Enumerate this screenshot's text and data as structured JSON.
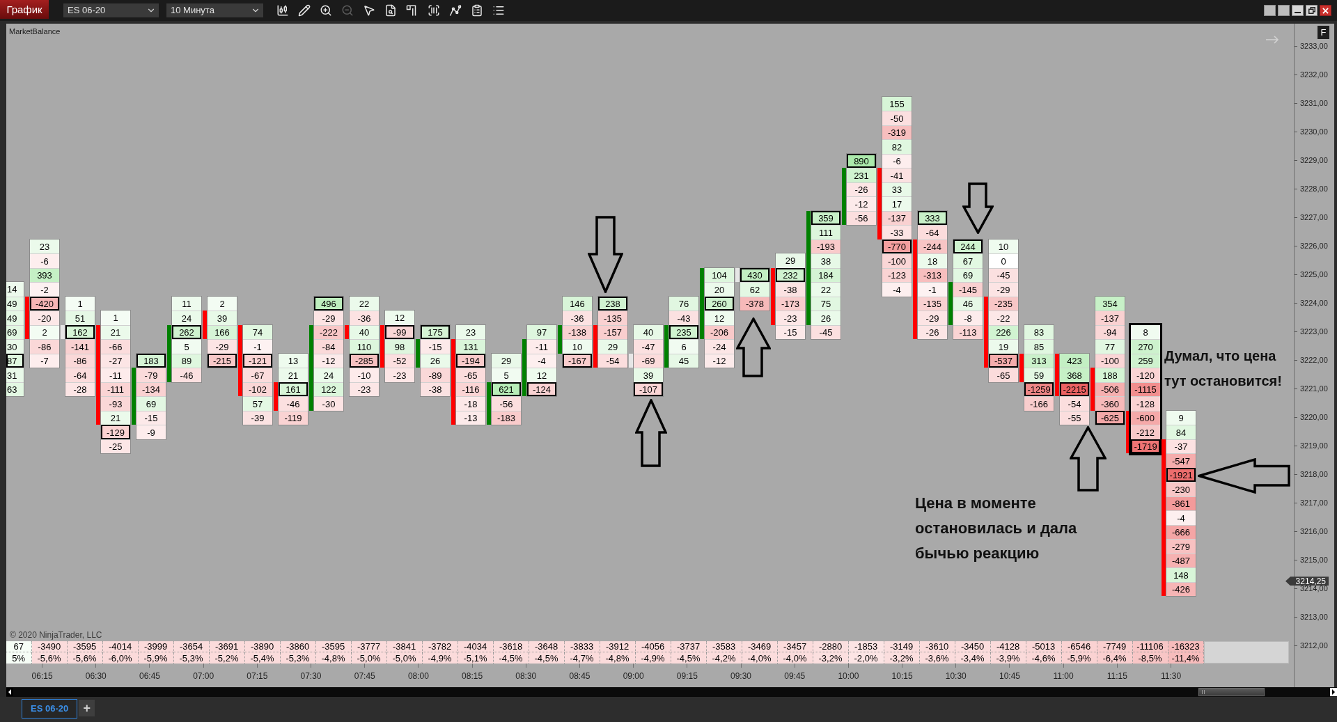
{
  "toolbar": {
    "chart_button": "График",
    "instrument": "ES 06-20",
    "interval": "10 Минута",
    "tools": [
      {
        "disabled": false
      },
      {
        "disabled": false
      },
      {
        "disabled": false
      },
      {
        "disabled": true
      },
      {
        "disabled": false
      },
      {
        "disabled": false
      },
      {
        "disabled": false
      },
      {
        "disabled": false
      },
      {
        "disabled": false
      },
      {
        "disabled": false
      },
      {
        "disabled": false
      }
    ]
  },
  "chart": {
    "indicator": "MarketBalance",
    "corner_button": "F",
    "columns": [
      {
        "clipped": true,
        "framed": false,
        "cells": [
          {
            "value": "14",
            "outlined": false
          },
          {
            "value": "49",
            "outlined": false
          },
          {
            "value": "49",
            "outlined": false
          },
          {
            "value": "69",
            "outlined": false
          },
          {
            "value": "30",
            "outlined": false
          },
          {
            "value": "87",
            "outlined": true
          },
          {
            "value": "31",
            "outlined": false
          },
          {
            "value": "63",
            "outlined": false
          }
        ]
      },
      {
        "clipped": false,
        "framed": false,
        "body": {
          "color": "#ff0000"
        },
        "cells": [
          {
            "value": "23",
            "outlined": false
          },
          {
            "value": "-6",
            "outlined": false
          },
          {
            "value": "393",
            "outlined": false
          },
          {
            "value": "-2",
            "outlined": false
          },
          {
            "value": "-420",
            "outlined": true
          },
          {
            "value": "-20",
            "outlined": false
          },
          {
            "value": "2",
            "outlined": false
          },
          {
            "value": "-86",
            "outlined": false
          },
          {
            "value": "-7",
            "outlined": false
          }
        ]
      },
      {
        "clipped": false,
        "framed": false,
        "body": {
          "color": "#e6e6e6"
        },
        "cells": [
          {
            "value": "1",
            "outlined": false
          },
          {
            "value": "51",
            "outlined": false
          },
          {
            "value": "162",
            "outlined": true
          },
          {
            "value": "-141",
            "outlined": false
          },
          {
            "value": "-86",
            "outlined": false
          },
          {
            "value": "-64",
            "outlined": false
          },
          {
            "value": "-28",
            "outlined": false
          }
        ]
      },
      {
        "clipped": false,
        "framed": false,
        "body": {
          "color": "#ff0000"
        },
        "cells": [
          {
            "value": "1",
            "outlined": false
          },
          {
            "value": "21",
            "outlined": false
          },
          {
            "value": "-66",
            "outlined": false
          },
          {
            "value": "-27",
            "outlined": false
          },
          {
            "value": "-11",
            "outlined": false
          },
          {
            "value": "-111",
            "outlined": false
          },
          {
            "value": "-93",
            "outlined": false
          },
          {
            "value": "21",
            "outlined": false
          },
          {
            "value": "-129",
            "outlined": true
          },
          {
            "value": "-25",
            "outlined": false
          }
        ]
      },
      {
        "clipped": false,
        "framed": false,
        "body": {
          "color": "#008000"
        },
        "cells": [
          {
            "value": "183",
            "outlined": true
          },
          {
            "value": "-79",
            "outlined": false
          },
          {
            "value": "-134",
            "outlined": false
          },
          {
            "value": "69",
            "outlined": false
          },
          {
            "value": "-15",
            "outlined": false
          },
          {
            "value": "-9",
            "outlined": false
          }
        ]
      },
      {
        "clipped": false,
        "framed": false,
        "body": {
          "color": "#008000"
        },
        "cells": [
          {
            "value": "11",
            "outlined": false
          },
          {
            "value": "24",
            "outlined": false
          },
          {
            "value": "262",
            "outlined": true
          },
          {
            "value": "5",
            "outlined": false
          },
          {
            "value": "89",
            "outlined": false
          },
          {
            "value": "-46",
            "outlined": false
          }
        ]
      },
      {
        "clipped": false,
        "framed": false,
        "body": {
          "color": "#ff0000"
        },
        "cells": [
          {
            "value": "2",
            "outlined": false
          },
          {
            "value": "39",
            "outlined": false
          },
          {
            "value": "166",
            "outlined": false
          },
          {
            "value": "-29",
            "outlined": false
          },
          {
            "value": "-215",
            "outlined": true
          }
        ]
      },
      {
        "clipped": false,
        "framed": false,
        "body": {
          "color": "#ff0000"
        },
        "cells": [
          {
            "value": "74",
            "outlined": false
          },
          {
            "value": "-1",
            "outlined": false
          },
          {
            "value": "-121",
            "outlined": true
          },
          {
            "value": "-67",
            "outlined": false
          },
          {
            "value": "-102",
            "outlined": false
          },
          {
            "value": "57",
            "outlined": false
          },
          {
            "value": "-39",
            "outlined": false
          }
        ]
      },
      {
        "clipped": false,
        "framed": false,
        "body": {
          "color": "#ff0000"
        },
        "cells": [
          {
            "value": "13",
            "outlined": false
          },
          {
            "value": "21",
            "outlined": false
          },
          {
            "value": "161",
            "outlined": true
          },
          {
            "value": "-46",
            "outlined": false
          },
          {
            "value": "-119",
            "outlined": false
          }
        ]
      },
      {
        "clipped": false,
        "framed": false,
        "body": {
          "color": "#008000"
        },
        "cells": [
          {
            "value": "496",
            "outlined": true
          },
          {
            "value": "-29",
            "outlined": false
          },
          {
            "value": "-222",
            "outlined": false
          },
          {
            "value": "-84",
            "outlined": false
          },
          {
            "value": "-12",
            "outlined": false
          },
          {
            "value": "24",
            "outlined": false
          },
          {
            "value": "122",
            "outlined": false
          },
          {
            "value": "-30",
            "outlined": false
          }
        ]
      },
      {
        "clipped": false,
        "framed": false,
        "body": {
          "color": "#ff0000"
        },
        "cells": [
          {
            "value": "22",
            "outlined": false
          },
          {
            "value": "-36",
            "outlined": false
          },
          {
            "value": "40",
            "outlined": false
          },
          {
            "value": "110",
            "outlined": false
          },
          {
            "value": "-285",
            "outlined": true
          },
          {
            "value": "-10",
            "outlined": false
          },
          {
            "value": "-23",
            "outlined": false
          }
        ]
      },
      {
        "clipped": false,
        "framed": false,
        "body": {
          "color": "#ff0000"
        },
        "cells": [
          {
            "value": "12",
            "outlined": false
          },
          {
            "value": "-99",
            "outlined": true
          },
          {
            "value": "98",
            "outlined": false
          },
          {
            "value": "-52",
            "outlined": false
          },
          {
            "value": "-23",
            "outlined": false
          }
        ]
      },
      {
        "clipped": false,
        "framed": false,
        "body": {
          "color": "#008000"
        },
        "cells": [
          {
            "value": "175",
            "outlined": true
          },
          {
            "value": "-15",
            "outlined": false
          },
          {
            "value": "26",
            "outlined": false
          },
          {
            "value": "-89",
            "outlined": false
          },
          {
            "value": "-38",
            "outlined": false
          }
        ]
      },
      {
        "clipped": false,
        "framed": false,
        "body": {
          "color": "#ff0000"
        },
        "cells": [
          {
            "value": "23",
            "outlined": false
          },
          {
            "value": "131",
            "outlined": false
          },
          {
            "value": "-194",
            "outlined": true
          },
          {
            "value": "-65",
            "outlined": false
          },
          {
            "value": "-116",
            "outlined": false
          },
          {
            "value": "-18",
            "outlined": false
          },
          {
            "value": "-13",
            "outlined": false
          }
        ]
      },
      {
        "clipped": false,
        "framed": false,
        "body": {
          "color": "#008000"
        },
        "cells": [
          {
            "value": "29",
            "outlined": false
          },
          {
            "value": "5",
            "outlined": false
          },
          {
            "value": "621",
            "outlined": true
          },
          {
            "value": "-56",
            "outlined": false
          },
          {
            "value": "-183",
            "outlined": false
          }
        ]
      },
      {
        "clipped": false,
        "framed": false,
        "body": {
          "color": "#008000"
        },
        "cells": [
          {
            "value": "97",
            "outlined": false
          },
          {
            "value": "-11",
            "outlined": false
          },
          {
            "value": "-4",
            "outlined": false
          },
          {
            "value": "12",
            "outlined": false
          },
          {
            "value": "-124",
            "outlined": true
          }
        ]
      },
      {
        "clipped": false,
        "framed": false,
        "body": {
          "color": "#008000"
        },
        "cells": [
          {
            "value": "146",
            "outlined": false
          },
          {
            "value": "-36",
            "outlined": false
          },
          {
            "value": "-138",
            "outlined": false
          },
          {
            "value": "10",
            "outlined": false
          },
          {
            "value": "-167",
            "outlined": true
          }
        ]
      },
      {
        "clipped": false,
        "framed": false,
        "body": {
          "color": "#ff0000"
        },
        "cells": [
          {
            "value": "238",
            "outlined": true
          },
          {
            "value": "-135",
            "outlined": false
          },
          {
            "value": "-157",
            "outlined": false
          },
          {
            "value": "29",
            "outlined": false
          },
          {
            "value": "-54",
            "outlined": false
          }
        ]
      },
      {
        "clipped": false,
        "framed": false,
        "body": {
          "color": "#e6e6e6"
        },
        "cells": [
          {
            "value": "40",
            "outlined": false
          },
          {
            "value": "-47",
            "outlined": false
          },
          {
            "value": "-69",
            "outlined": false
          },
          {
            "value": "39",
            "outlined": false
          },
          {
            "value": "-107",
            "outlined": true
          }
        ]
      },
      {
        "clipped": false,
        "framed": false,
        "body": {
          "color": "#008000"
        },
        "cells": [
          {
            "value": "76",
            "outlined": false
          },
          {
            "value": "-43",
            "outlined": false
          },
          {
            "value": "235",
            "outlined": true
          },
          {
            "value": "6",
            "outlined": false
          },
          {
            "value": "45",
            "outlined": false
          }
        ]
      },
      {
        "clipped": false,
        "framed": false,
        "body": {
          "color": "#008000"
        },
        "cells": [
          {
            "value": "104",
            "outlined": false
          },
          {
            "value": "20",
            "outlined": false
          },
          {
            "value": "260",
            "outlined": true
          },
          {
            "value": "12",
            "outlined": false
          },
          {
            "value": "-206",
            "outlined": false
          },
          {
            "value": "-24",
            "outlined": false
          },
          {
            "value": "-12",
            "outlined": false
          }
        ]
      },
      {
        "clipped": false,
        "framed": false,
        "body": {
          "color": "#e6e6e6"
        },
        "cells": [
          {
            "value": "430",
            "outlined": true
          },
          {
            "value": "62",
            "outlined": false
          },
          {
            "value": "-378",
            "outlined": false
          }
        ]
      },
      {
        "clipped": false,
        "framed": false,
        "body": {
          "color": "#ff0000"
        },
        "cells": [
          {
            "value": "29",
            "outlined": false
          },
          {
            "value": "232",
            "outlined": true
          },
          {
            "value": "-38",
            "outlined": false
          },
          {
            "value": "-173",
            "outlined": false
          },
          {
            "value": "-23",
            "outlined": false
          },
          {
            "value": "-15",
            "outlined": false
          }
        ]
      },
      {
        "clipped": false,
        "framed": false,
        "body": {
          "color": "#008000"
        },
        "cells": [
          {
            "value": "359",
            "outlined": true
          },
          {
            "value": "111",
            "outlined": false
          },
          {
            "value": "-193",
            "outlined": false
          },
          {
            "value": "38",
            "outlined": false
          },
          {
            "value": "184",
            "outlined": false
          },
          {
            "value": "22",
            "outlined": false
          },
          {
            "value": "75",
            "outlined": false
          },
          {
            "value": "26",
            "outlined": false
          },
          {
            "value": "-45",
            "outlined": false
          }
        ]
      },
      {
        "clipped": false,
        "framed": false,
        "body": {
          "color": "#008000"
        },
        "cells": [
          {
            "value": "890",
            "outlined": true
          },
          {
            "value": "231",
            "outlined": false
          },
          {
            "value": "-26",
            "outlined": false
          },
          {
            "value": "-12",
            "outlined": false
          },
          {
            "value": "-56",
            "outlined": false
          }
        ]
      },
      {
        "clipped": false,
        "framed": false,
        "body": {
          "color": "#ff0000"
        },
        "cells": [
          {
            "value": "155",
            "outlined": false
          },
          {
            "value": "-50",
            "outlined": false
          },
          {
            "value": "-319",
            "outlined": false
          },
          {
            "value": "82",
            "outlined": false
          },
          {
            "value": "-6",
            "outlined": false
          },
          {
            "value": "-41",
            "outlined": false
          },
          {
            "value": "33",
            "outlined": false
          },
          {
            "value": "17",
            "outlined": false
          },
          {
            "value": "-137",
            "outlined": false
          },
          {
            "value": "-33",
            "outlined": false
          },
          {
            "value": "-770",
            "outlined": true
          },
          {
            "value": "-100",
            "outlined": false
          },
          {
            "value": "-123",
            "outlined": false
          },
          {
            "value": "-4",
            "outlined": false
          }
        ]
      },
      {
        "clipped": false,
        "framed": false,
        "body": {
          "color": "#ff0000"
        },
        "cells": [
          {
            "value": "333",
            "outlined": true
          },
          {
            "value": "-64",
            "outlined": false
          },
          {
            "value": "-244",
            "outlined": false
          },
          {
            "value": "18",
            "outlined": false
          },
          {
            "value": "-313",
            "outlined": false
          },
          {
            "value": "-1",
            "outlined": false
          },
          {
            "value": "-135",
            "outlined": false
          },
          {
            "value": "-29",
            "outlined": false
          },
          {
            "value": "-26",
            "outlined": false
          }
        ]
      },
      {
        "clipped": false,
        "framed": false,
        "body": {
          "color": "#008000"
        },
        "cells": [
          {
            "value": "244",
            "outlined": true
          },
          {
            "value": "67",
            "outlined": false
          },
          {
            "value": "69",
            "outlined": false
          },
          {
            "value": "-145",
            "outlined": false
          },
          {
            "value": "46",
            "outlined": false
          },
          {
            "value": "-8",
            "outlined": false
          },
          {
            "value": "-113",
            "outlined": false
          }
        ]
      },
      {
        "clipped": false,
        "framed": false,
        "body": {
          "color": "#ff0000"
        },
        "cells": [
          {
            "value": "10",
            "outlined": false
          },
          {
            "value": "0",
            "outlined": false
          },
          {
            "value": "-45",
            "outlined": false
          },
          {
            "value": "-29",
            "outlined": false
          },
          {
            "value": "-235",
            "outlined": false
          },
          {
            "value": "-22",
            "outlined": false
          },
          {
            "value": "226",
            "outlined": false
          },
          {
            "value": "19",
            "outlined": false
          },
          {
            "value": "-537",
            "outlined": true
          },
          {
            "value": "-65",
            "outlined": false
          }
        ]
      },
      {
        "clipped": false,
        "framed": false,
        "body": {
          "color": "#ff0000"
        },
        "cells": [
          {
            "value": "83",
            "outlined": false
          },
          {
            "value": "85",
            "outlined": false
          },
          {
            "value": "313",
            "outlined": false
          },
          {
            "value": "59",
            "outlined": false
          },
          {
            "value": "-1259",
            "outlined": true
          },
          {
            "value": "-166",
            "outlined": false
          }
        ]
      },
      {
        "clipped": false,
        "framed": false,
        "body": {
          "color": "#ff0000"
        },
        "cells": [
          {
            "value": "423",
            "outlined": false
          },
          {
            "value": "368",
            "outlined": false
          },
          {
            "value": "-2215",
            "outlined": true
          },
          {
            "value": "-54",
            "outlined": false
          },
          {
            "value": "-55",
            "outlined": false
          }
        ]
      },
      {
        "clipped": false,
        "framed": false,
        "body": {
          "color": "#ff0000"
        },
        "cells": [
          {
            "value": "354",
            "outlined": false
          },
          {
            "value": "-137",
            "outlined": false
          },
          {
            "value": "-94",
            "outlined": false
          },
          {
            "value": "77",
            "outlined": false
          },
          {
            "value": "-100",
            "outlined": false
          },
          {
            "value": "188",
            "outlined": false
          },
          {
            "value": "-506",
            "outlined": false
          },
          {
            "value": "-360",
            "outlined": false
          },
          {
            "value": "-625",
            "outlined": true
          }
        ]
      },
      {
        "clipped": false,
        "framed": true,
        "body": {
          "color": "#ff0000"
        },
        "cells": [
          {
            "value": "8",
            "outlined": false
          },
          {
            "value": "270",
            "outlined": false
          },
          {
            "value": "259",
            "outlined": false
          },
          {
            "value": "-120",
            "outlined": false
          },
          {
            "value": "-1115",
            "outlined": false
          },
          {
            "value": "-128",
            "outlined": false
          },
          {
            "value": "-600",
            "outlined": false
          },
          {
            "value": "-212",
            "outlined": false
          },
          {
            "value": "-1719",
            "outlined": true
          }
        ]
      },
      {
        "clipped": false,
        "framed": false,
        "body": {
          "color": "#ff0000"
        },
        "cells": [
          {
            "value": "9",
            "outlined": false
          },
          {
            "value": "84",
            "outlined": false
          },
          {
            "value": "-37",
            "outlined": false
          },
          {
            "value": "-547",
            "outlined": false
          },
          {
            "value": "-1921",
            "outlined": true
          },
          {
            "value": "-230",
            "outlined": false
          },
          {
            "value": "-861",
            "outlined": false
          },
          {
            "value": "-4",
            "outlined": false
          },
          {
            "value": "-666",
            "outlined": false
          },
          {
            "value": "-279",
            "outlined": false
          },
          {
            "value": "-487",
            "outlined": false
          },
          {
            "value": "148",
            "outlined": false
          },
          {
            "value": "-426",
            "outlined": false
          }
        ]
      }
    ],
    "delta_table": [
      {
        "delta": "67",
        "percent": "5%"
      },
      {
        "delta": "-3490",
        "percent": "-5,6%"
      },
      {
        "delta": "-3595",
        "percent": "-5,6%"
      },
      {
        "delta": "-4014",
        "percent": "-6,0%"
      },
      {
        "delta": "-3999",
        "percent": "-5,9%"
      },
      {
        "delta": "-3654",
        "percent": "-5,3%"
      },
      {
        "delta": "-3691",
        "percent": "-5,2%"
      },
      {
        "delta": "-3890",
        "percent": "-5,4%"
      },
      {
        "delta": "-3860",
        "percent": "-5,3%"
      },
      {
        "delta": "-3595",
        "percent": "-4,8%"
      },
      {
        "delta": "-3777",
        "percent": "-5,0%"
      },
      {
        "delta": "-3841",
        "percent": "-5,0%"
      },
      {
        "delta": "-3782",
        "percent": "-4,9%"
      },
      {
        "delta": "-4034",
        "percent": "-5,1%"
      },
      {
        "delta": "-3618",
        "percent": "-4,5%"
      },
      {
        "delta": "-3648",
        "percent": "-4,5%"
      },
      {
        "delta": "-3833",
        "percent": "-4,7%"
      },
      {
        "delta": "-3912",
        "percent": "-4,8%"
      },
      {
        "delta": "-4056",
        "percent": "-4,9%"
      },
      {
        "delta": "-3737",
        "percent": "-4,5%"
      },
      {
        "delta": "-3583",
        "percent": "-4,2%"
      },
      {
        "delta": "-3469",
        "percent": "-4,0%"
      },
      {
        "delta": "-3457",
        "percent": "-4,0%"
      },
      {
        "delta": "-2880",
        "percent": "-3,2%"
      },
      {
        "delta": "-1853",
        "percent": "-2,0%"
      },
      {
        "delta": "-3149",
        "percent": "-3,2%"
      },
      {
        "delta": "-3610",
        "percent": "-3,6%"
      },
      {
        "delta": "-3450",
        "percent": "-3,4%"
      },
      {
        "delta": "-4128",
        "percent": "-3,9%"
      },
      {
        "delta": "-5013",
        "percent": "-4,6%"
      },
      {
        "delta": "-6546",
        "percent": "-5,9%"
      },
      {
        "delta": "-7749",
        "percent": "-6,4%"
      },
      {
        "delta": "-11106",
        "percent": "-8,5%"
      },
      {
        "delta": "-16323",
        "percent": "-11,4%"
      }
    ],
    "copyright": "© 2020 NinjaTrader, LLC",
    "time_axis": [
      "06:15",
      "06:30",
      "06:45",
      "07:00",
      "07:15",
      "07:30",
      "07:45",
      "08:00",
      "08:15",
      "08:30",
      "08:45",
      "09:00",
      "09:15",
      "09:30",
      "09:45",
      "10:00",
      "10:15",
      "10:30",
      "10:45",
      "11:00",
      "11:15",
      "11:30"
    ],
    "price_axis": {
      "labels": [
        "3233,00",
        "3232,00",
        "3231,00",
        "3230,00",
        "3229,00",
        "3228,00",
        "3227,00",
        "3226,00",
        "3225,00",
        "3224,00",
        "3223,00",
        "3222,00",
        "3221,00",
        "3220,00",
        "3219,00",
        "3218,00",
        "3217,00",
        "3216,00",
        "3215,00",
        "3214,00",
        "3213,00",
        "3212,00"
      ],
      "current_price": "3214,25"
    },
    "notes": [
      "Думал, что цена\nтут остановится!",
      "Цена в моменте\nостановилась и дала\nбычью реакцию"
    ]
  },
  "tabs": [
    {
      "label": "ES 06-20",
      "selected": true
    }
  ],
  "add_tab": "+"
}
